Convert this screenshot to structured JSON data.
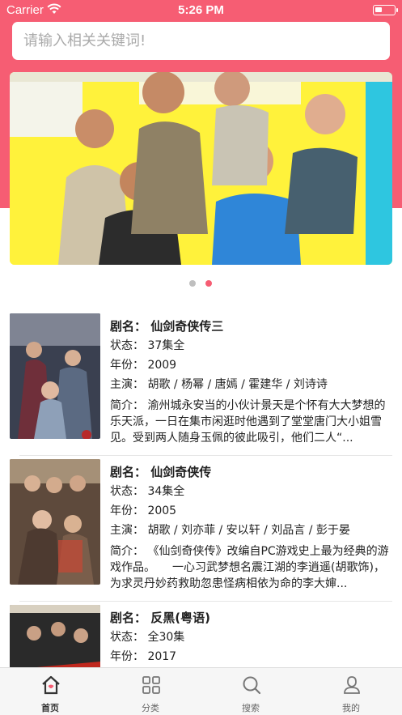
{
  "status_bar": {
    "carrier": "Carrier",
    "time": "5:26 PM"
  },
  "search": {
    "placeholder": "请输入相关关键词!"
  },
  "banner": {
    "pages": 2,
    "active_page": 2
  },
  "list": [
    {
      "title": "剧名：  仙剑奇侠传三",
      "status": "状态：  37集全",
      "year": "年份：  2009",
      "cast": "主演：  胡歌 / 杨幂 / 唐嫣 / 霍建华 / 刘诗诗",
      "summary": "简介：  渝州城永安当的小伙计景天是个怀有大大梦想的乐天派，一日在集市闲逛时他遇到了堂堂唐门大小姐雪见。受到两人随身玉佩的彼此吸引，他们二人“..."
    },
    {
      "title": "剧名：  仙剑奇侠传",
      "status": "状态：  34集全",
      "year": "年份：  2005",
      "cast": "主演：  胡歌 / 刘亦菲 / 安以轩 / 刘品言 / 彭于晏",
      "summary": "简介：  《仙剑奇侠传》改编自PC游戏史上最为经典的游戏作品。　　一心习武梦想名震江湖的李逍遥(胡歌饰)，为求灵丹妙药救助忽患怪病相依为命的李大婶..."
    },
    {
      "title": "剧名：  反黑(粤语)",
      "status": "状态：  全30集",
      "year": "年份：  2017",
      "cast": "",
      "summary": ""
    }
  ],
  "tabs": [
    {
      "label": "首页",
      "icon": "home-icon",
      "active": true
    },
    {
      "label": "分类",
      "icon": "grid-icon",
      "active": false
    },
    {
      "label": "搜索",
      "icon": "search-icon",
      "active": false
    },
    {
      "label": "我的",
      "icon": "user-icon",
      "active": false
    }
  ],
  "colors": {
    "accent": "#f65d73",
    "tab_active": "#333333",
    "tab_inactive": "#777777"
  }
}
